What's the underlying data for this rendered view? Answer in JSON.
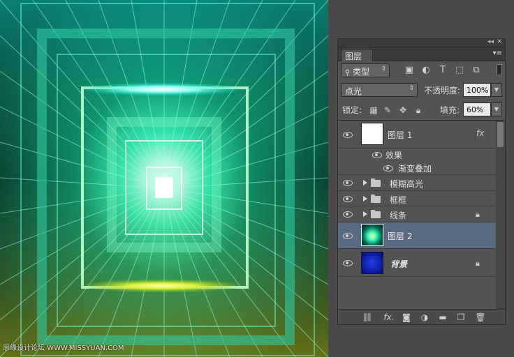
{
  "canvas": {
    "watermark": "思缘设计论坛 WWW.MISSYUAN.COM"
  },
  "panel": {
    "collapse_icon": "double-chevron-icon",
    "close_glyph": "▾≡",
    "tab_label": "图层",
    "filter": {
      "selected": "类型",
      "icon": "search-icon"
    },
    "filter_icons": [
      "image-filter-icon",
      "adjustment-filter-icon",
      "type-filter-icon",
      "shape-filter-icon",
      "smart-object-filter-icon"
    ],
    "blend_mode": "点光",
    "opacity_label": "不透明度:",
    "opacity_value": "100%",
    "lock_label": "锁定:",
    "lock_icons": [
      "lock-transparent-icon",
      "lock-paint-icon",
      "lock-move-icon",
      "lock-all-icon"
    ],
    "fill_label": "填充:",
    "fill_value": "60%",
    "layers": [
      {
        "name": "图层 1",
        "type": "layer",
        "has_fx": true,
        "fx_label": "fx",
        "visible": true,
        "locked": false,
        "thumb": "white"
      },
      {
        "name": "效果",
        "type": "effects-header",
        "visible": true
      },
      {
        "name": "渐变叠加",
        "type": "effect",
        "visible": true
      },
      {
        "name": "模糊高光",
        "type": "group",
        "visible": true,
        "locked": false
      },
      {
        "name": "框框",
        "type": "group",
        "visible": true,
        "locked": false
      },
      {
        "name": "线条",
        "type": "group",
        "visible": true,
        "locked": true
      },
      {
        "name": "图层 2",
        "type": "layer",
        "visible": true,
        "locked": false,
        "selected": true,
        "thumb": "tunnel"
      },
      {
        "name": "背景",
        "type": "layer",
        "visible": true,
        "locked": true,
        "thumb": "blue",
        "italic": true
      }
    ],
    "bottom_icons": [
      "link-layers-icon",
      "fx-icon",
      "add-mask-icon",
      "adjustment-layer-icon",
      "new-group-icon",
      "new-layer-icon",
      "delete-layer-icon"
    ],
    "bottom_fx_label": "fx."
  },
  "colors": {
    "selected_row": "#5a6a80",
    "panel_bg": "#535353",
    "canvas_glow": "#7affd0"
  }
}
